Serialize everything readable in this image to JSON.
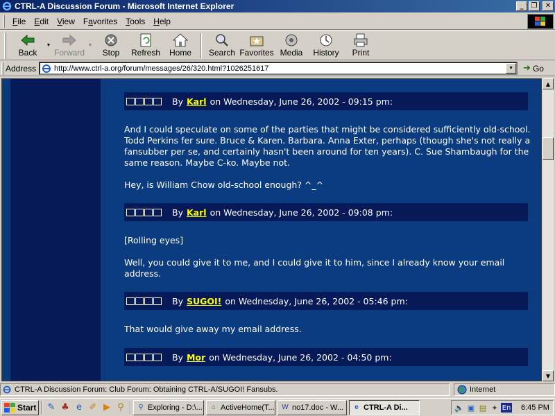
{
  "window": {
    "title": "CTRL-A Discussion Forum - Microsoft Internet Explorer",
    "minimize": "_",
    "maximize": "❐",
    "close": "✕"
  },
  "menu": [
    "File",
    "Edit",
    "View",
    "Favorites",
    "Tools",
    "Help"
  ],
  "menu_underlines": [
    "F",
    "E",
    "V",
    "a",
    "T",
    "H"
  ],
  "toolbar": {
    "back": "Back",
    "forward": "Forward",
    "stop": "Stop",
    "refresh": "Refresh",
    "home": "Home",
    "search": "Search",
    "favorites": "Favorites",
    "media": "Media",
    "history": "History",
    "print": "Print"
  },
  "address": {
    "label": "Address",
    "url": "http://www.ctrl-a.org/forum/messages/26/320.html?1026251617",
    "go": "Go"
  },
  "posts": [
    {
      "by": "By",
      "author": "Karl",
      "date": "on Wednesday, June 26, 2002 - 09:15 pm:",
      "paragraphs": [
        "And I could speculate on some of the parties that might be considered sufficiently old-school. Todd Perkins fer sure. Bruce & Karen. Barbara. Anna Exter, perhaps (though she's not really a fansubber per se, and certainly hasn't been around for ten years). C. Sue Shambaugh for the same reason. Maybe C-ko. Maybe not.",
        "Hey, is William Chow old-school enough? ^_^"
      ]
    },
    {
      "by": "By",
      "author": "Karl",
      "date": "on Wednesday, June 26, 2002 - 09:08 pm:",
      "paragraphs": [
        "[Rolling eyes]",
        "Well, you could give it to me, and I could give it to him, since I already know your email address."
      ]
    },
    {
      "by": "By",
      "author": "SUGOI!",
      "date": "on Wednesday, June 26, 2002 - 05:46 pm:",
      "paragraphs": [
        "That would give away my email address."
      ]
    },
    {
      "by": "By",
      "author": "Mor",
      "date": "on Wednesday, June 26, 2002 - 04:50 pm:",
      "paragraphs": []
    }
  ],
  "status": {
    "text": "CTRL-A Discussion Forum: Club Forum: Obtaining CTRL-A/SUGOI! Fansubs.",
    "zone": "Internet"
  },
  "taskbar": {
    "start": "Start",
    "tasks": [
      {
        "label": "Exploring - D:\\...",
        "active": false
      },
      {
        "label": "ActiveHome(T...",
        "active": false
      },
      {
        "label": "no17.doc - W...",
        "active": false
      },
      {
        "label": "CTRL-A Di...",
        "active": true
      }
    ],
    "lang": "En",
    "clock": "6:45 PM"
  }
}
